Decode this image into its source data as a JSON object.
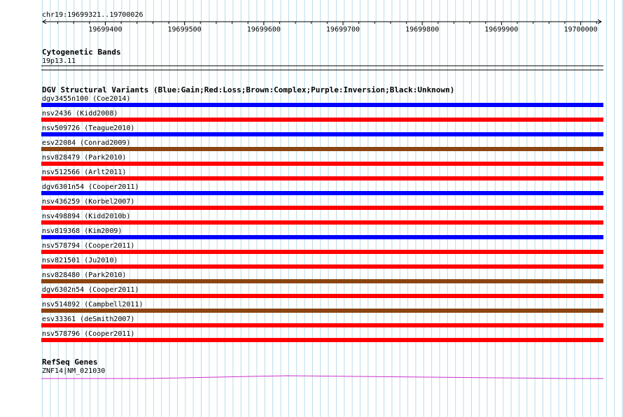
{
  "ruler": {
    "region_label": "chr19:19699321..19700026",
    "start": 19699321,
    "end": 19700026,
    "ticks": [
      "19699400",
      "19699500",
      "19699600",
      "19699700",
      "19699800",
      "19699900",
      "19700000"
    ]
  },
  "cytoband": {
    "title": "Cytogenetic Bands",
    "band": "19p13.11"
  },
  "dgv": {
    "title": "DGV Structural Variants (Blue:Gain;Red:Loss;Brown:Complex;Purple:Inversion;Black:Unknown)",
    "type_colors": {
      "gain": "#0000ff",
      "loss": "#ff0000",
      "complex": "#8b4513"
    },
    "variants": [
      {
        "label": "dgv3455n100 (Coe2014)",
        "type": "gain"
      },
      {
        "label": "nsv2436 (Kidd2008)",
        "type": "loss"
      },
      {
        "label": "nsv509726 (Teague2010)",
        "type": "gain"
      },
      {
        "label": "esv22084 (Conrad2009)",
        "type": "complex"
      },
      {
        "label": "nsv828479 (Park2010)",
        "type": "loss"
      },
      {
        "label": "nsv512566 (Arlt2011)",
        "type": "loss"
      },
      {
        "label": "dgv6301n54 (Cooper2011)",
        "type": "gain"
      },
      {
        "label": "nsv436259 (Korbel2007)",
        "type": "loss"
      },
      {
        "label": "nsv498894 (Kidd2010b)",
        "type": "loss"
      },
      {
        "label": "nsv819368 (Kim2009)",
        "type": "gain"
      },
      {
        "label": "nsv578794 (Cooper2011)",
        "type": "loss"
      },
      {
        "label": "nsv821501 (Ju2010)",
        "type": "loss"
      },
      {
        "label": "nsv828480 (Park2010)",
        "type": "complex"
      },
      {
        "label": "dgv6302n54 (Cooper2011)",
        "type": "loss"
      },
      {
        "label": "nsv514892 (Campbell2011)",
        "type": "complex"
      },
      {
        "label": "esv33361 (deSmith2007)",
        "type": "loss"
      },
      {
        "label": "nsv578796 (Cooper2011)",
        "type": "loss"
      }
    ]
  },
  "refseq": {
    "title": "RefSeq Genes",
    "gene": "ZNF14|NM_021030",
    "color": "#cc33cc"
  }
}
